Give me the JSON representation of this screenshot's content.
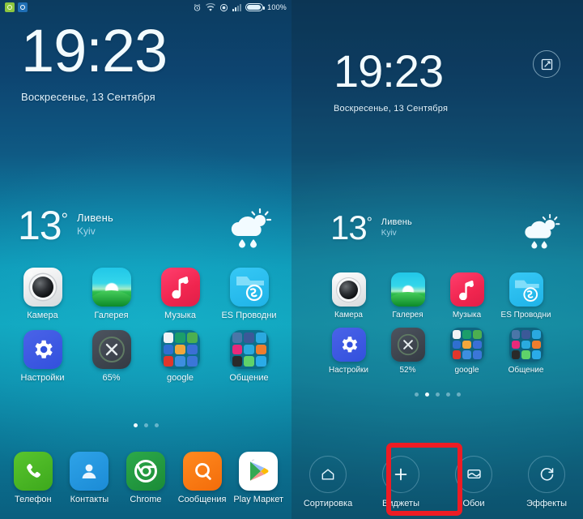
{
  "status_bar": {
    "notification_icons": [
      "app-notification-green-icon",
      "app-notification-blue-icon"
    ],
    "system_icons": [
      "alarm-icon",
      "wifi-icon",
      "dnd-icon",
      "signal-icon",
      "battery-icon"
    ],
    "battery_text": "100%"
  },
  "clock": {
    "time": "19:23",
    "date": "Воскресенье, 13 Сентября"
  },
  "weather": {
    "temperature": "13",
    "degree": "°",
    "condition": "Ливень",
    "city": "Kyiv",
    "icon": "rain-sun-cloud-icon"
  },
  "apps": {
    "row1": [
      {
        "label": "Камера",
        "icon": "camera-icon"
      },
      {
        "label": "Галерея",
        "icon": "gallery-icon"
      },
      {
        "label": "Музыка",
        "icon": "music-icon"
      },
      {
        "label": "ES Проводни",
        "icon": "es-file-explorer-icon"
      }
    ],
    "row2": [
      {
        "label": "Настройки",
        "icon": "settings-gear-icon"
      },
      {
        "label_left": "65%",
        "label_right": "52%",
        "icon": "cleaner-icon"
      },
      {
        "label": "google",
        "icon": "google-folder-icon"
      },
      {
        "label": "Общение",
        "icon": "social-folder-icon"
      }
    ]
  },
  "folders": {
    "google_colors": [
      "#f0f3f6",
      "#1b9e6a",
      "#4caf50",
      "#2f6fd0",
      "#f1a73b",
      "#3b6fd6",
      "#e0362c",
      "#3d8ee0",
      "#3b76d8"
    ],
    "social_colors": [
      "#4a76a8",
      "#3b5998",
      "#2aa9e0",
      "#e8297a",
      "#2aaade",
      "#ef7d2e",
      "#2a2a2a",
      "#5fd26a",
      "#2aabe8"
    ]
  },
  "page_indicator": {
    "left_pages": 3,
    "left_active": 0,
    "right_pages": 5,
    "right_active": 1
  },
  "dock": [
    {
      "label": "Телефон",
      "icon": "phone-icon"
    },
    {
      "label": "Контакты",
      "icon": "contacts-icon"
    },
    {
      "label": "Chrome",
      "icon": "chrome-icon"
    },
    {
      "label": "Сообщения",
      "icon": "messages-icon"
    },
    {
      "label": "Play Маркет",
      "icon": "play-store-icon"
    }
  ],
  "edit_mode": {
    "edit_badge_icon": "edit-pencil-square-icon",
    "toolbar": [
      {
        "label": "Сортировка",
        "icon": "home-outline-icon"
      },
      {
        "label": "Виджеты",
        "icon": "plus-icon"
      },
      {
        "label": "Обои",
        "icon": "wallpaper-image-icon"
      },
      {
        "label": "Эффекты",
        "icon": "refresh-effects-icon"
      }
    ],
    "highlight": {
      "target": "Виджеты",
      "color": "#ed1c24"
    }
  }
}
